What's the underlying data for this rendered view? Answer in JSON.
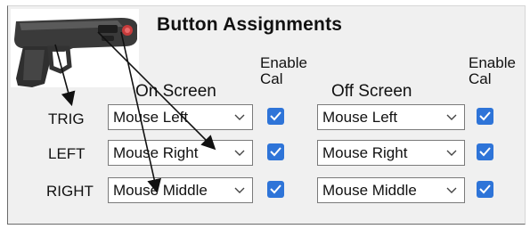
{
  "window": {
    "title": "Button Assignments"
  },
  "headers": {
    "enable_cal_on": "Enable\nCal",
    "enable_cal_off": "Enable\nCal",
    "on_screen": "On Screen",
    "off_screen": "Off Screen"
  },
  "rows": [
    {
      "label": "TRIG",
      "on_value": "Mouse Left",
      "on_cal": true,
      "off_value": "Mouse Left",
      "off_cal": true
    },
    {
      "label": "LEFT",
      "on_value": "Mouse Right",
      "on_cal": true,
      "off_value": "Mouse Right",
      "off_cal": true
    },
    {
      "label": "RIGHT",
      "on_value": "Mouse Middle",
      "on_cal": true,
      "off_value": "Mouse Middle",
      "off_cal": true
    }
  ],
  "colors": {
    "panel_bg": "#f0f0f0",
    "checkbox_accent": "#2e74d8"
  },
  "icons": {
    "gun": "light-gun-icon",
    "dropdown": "chevron-down-icon",
    "checkbox": "checkmark-icon"
  }
}
